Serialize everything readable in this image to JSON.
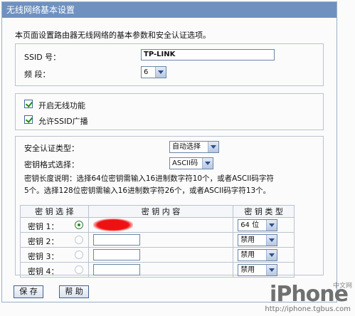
{
  "window": {
    "title": "无线网络基本设置"
  },
  "intro_text": "本页面设置路由器无线网络的基本参数和安全认证选项。",
  "basic": {
    "ssid_label": "SSID 号：",
    "ssid_value": "TP-LINK",
    "channel_label": "频  段：",
    "channel_value": "6"
  },
  "options": {
    "enable_wireless": {
      "label": "开启无线功能",
      "checked": true
    },
    "allow_ssid_broadcast": {
      "label": "允许SSID广播",
      "checked": true
    }
  },
  "security": {
    "auth_type_label": "安全认证类型：",
    "auth_type_value": "自动选择",
    "key_format_label": "密钥格式选择：",
    "key_format_value": "ASCII码",
    "note_line1": "密钥长度说明：选择64位密钥需输入16进制数字符10个，或者ASCII码字符",
    "note_line2": "5个。选择128位密钥需输入16进制数字符26个，或者ASCII码字符13个。"
  },
  "key_table": {
    "headers": [
      "密 钥 选 择",
      "密 钥 内 容",
      "密 钥 类 型"
    ],
    "rows": [
      {
        "label": "密钥 1：",
        "selected": true,
        "type": "64 位"
      },
      {
        "label": "密钥 2：",
        "selected": false,
        "type": "禁用"
      },
      {
        "label": "密钥 3：",
        "selected": false,
        "type": "禁用"
      },
      {
        "label": "密钥 4：",
        "selected": false,
        "type": "禁用"
      }
    ]
  },
  "buttons": {
    "save": "保 存",
    "help": "帮 助"
  },
  "watermark": {
    "logo": "iPhone",
    "site": "http://iphone.tgbus.com",
    "cn": "中文网"
  },
  "colors": {
    "titlebar": "#6f91c0",
    "border": "#b9c3cf",
    "accent_green": "#2c8a2c"
  }
}
